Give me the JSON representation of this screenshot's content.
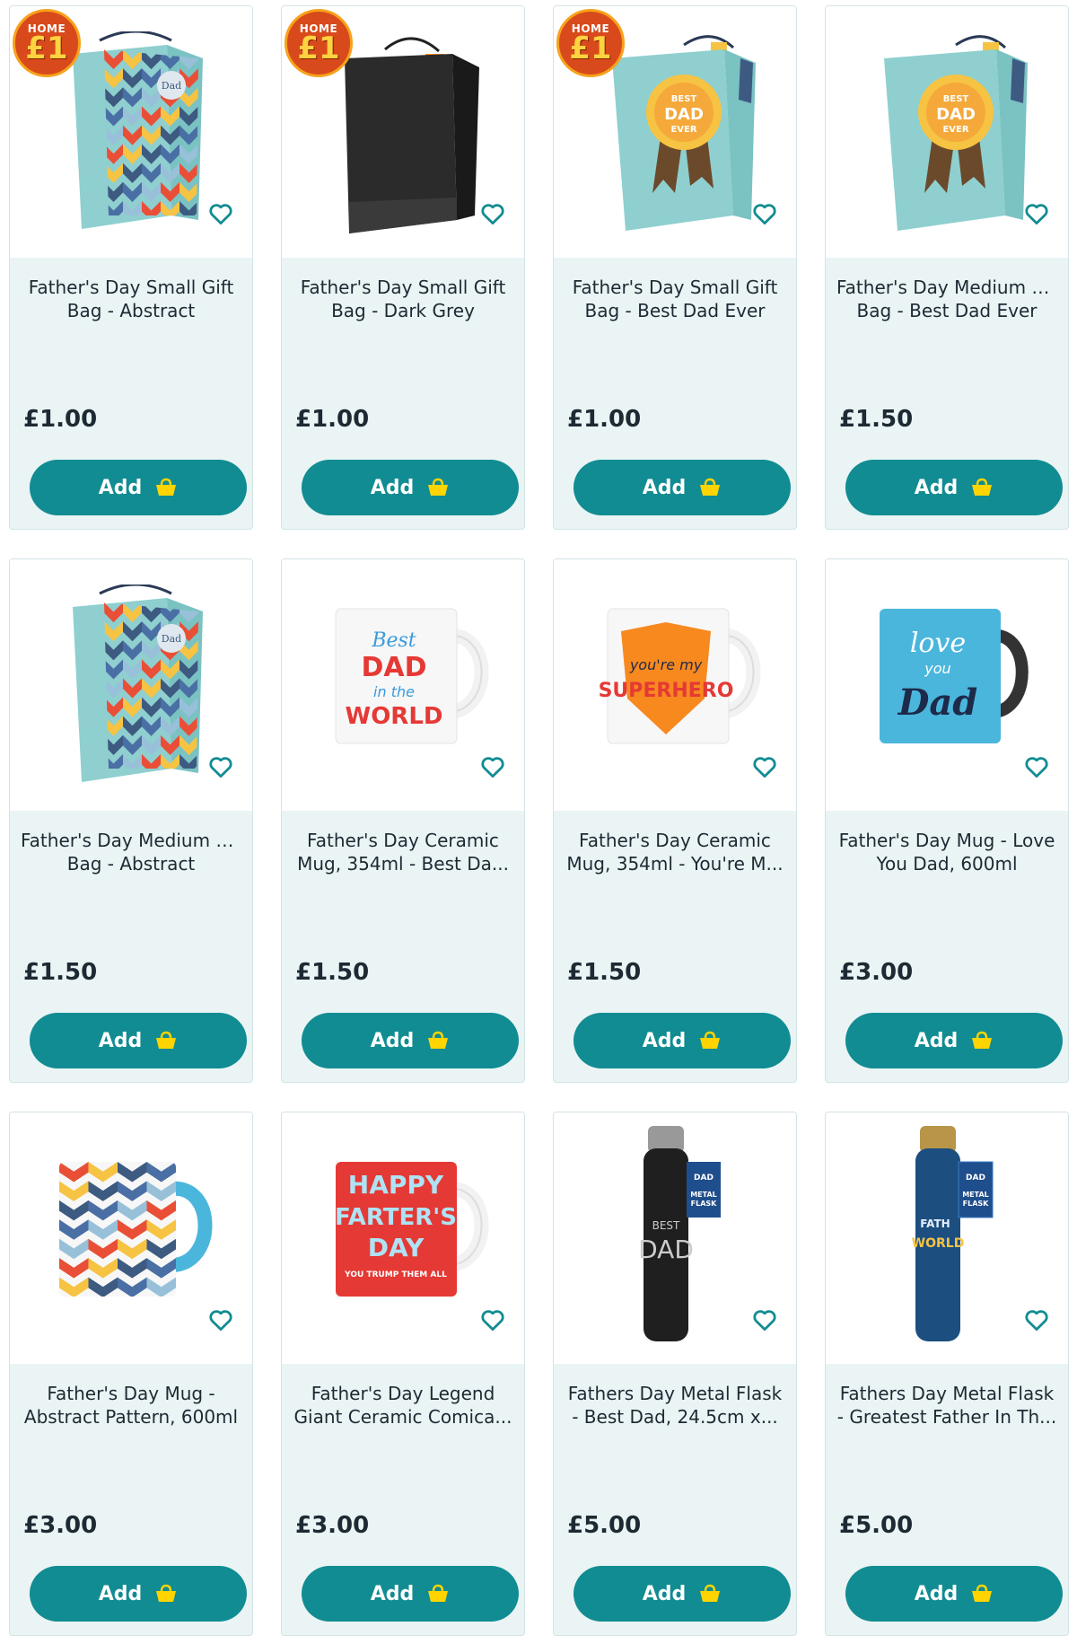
{
  "badge": {
    "line1": "HOME",
    "line2": "£1"
  },
  "add_label": "Add",
  "colors": {
    "accent": "#118c92",
    "card_bg": "#eaf4f5",
    "basket": "#ffd400",
    "badge": "#d84a1b"
  },
  "products": [
    {
      "title_l1": "Father's Day Small Gift",
      "title_l2": "Bag - Abstract",
      "price": "£1.00",
      "badge": true,
      "image": "gift-bag-chevron"
    },
    {
      "title_l1": "Father's Day Small Gift",
      "title_l2": "Bag - Dark Grey",
      "price": "£1.00",
      "badge": true,
      "image": "gift-bag-black"
    },
    {
      "title_l1": "Father's Day Small Gift",
      "title_l2": "Bag - Best Dad Ever",
      "price": "£1.00",
      "badge": true,
      "image": "gift-bag-rosette"
    },
    {
      "title_l1": "Father's Day Medium Gift",
      "title_l2": "Bag - Best Dad Ever",
      "price": "£1.50",
      "badge": false,
      "image": "gift-bag-rosette"
    },
    {
      "title_l1": "Father's Day Medium Gift",
      "title_l2": "Bag - Abstract",
      "price": "£1.50",
      "badge": false,
      "image": "gift-bag-chevron"
    },
    {
      "title_l1": "Father's Day Ceramic",
      "title_l2": "Mug, 354ml - Best Da...",
      "price": "£1.50",
      "badge": false,
      "image": "mug-best-dad"
    },
    {
      "title_l1": "Father's Day Ceramic",
      "title_l2": "Mug, 354ml - You're M...",
      "price": "£1.50",
      "badge": false,
      "image": "mug-superhero"
    },
    {
      "title_l1": "Father's Day Mug - Love",
      "title_l2": "You Dad, 600ml",
      "price": "£3.00",
      "badge": false,
      "image": "mug-love-you-dad"
    },
    {
      "title_l1": "Father's Day Mug -",
      "title_l2": "Abstract Pattern, 600ml",
      "price": "£3.00",
      "badge": false,
      "image": "mug-chevron"
    },
    {
      "title_l1": "Father's Day Legend",
      "title_l2": "Giant Ceramic Comica...",
      "price": "£3.00",
      "badge": false,
      "image": "mug-farters-day"
    },
    {
      "title_l1": "Fathers Day Metal Flask",
      "title_l2": "- Best Dad, 24.5cm x...",
      "price": "£5.00",
      "badge": false,
      "image": "flask-black"
    },
    {
      "title_l1": "Fathers Day Metal Flask",
      "title_l2": "- Greatest Father In Th...",
      "price": "£5.00",
      "badge": false,
      "image": "flask-blue"
    }
  ],
  "art": {
    "mug_best": [
      "Best",
      "DAD",
      "in the",
      "WORLD"
    ],
    "mug_super": [
      "you're my",
      "SUPERHERO"
    ],
    "mug_love": [
      "love",
      "you",
      "Dad"
    ],
    "mug_farters": [
      "HAPPY",
      "FARTER'S",
      "DAY",
      "YOU TRUMP THEM ALL"
    ],
    "flask_tag": [
      "DAD",
      "METAL",
      "FLASK"
    ],
    "flask_black": [
      "BEST",
      "DAD"
    ],
    "flask_blue": [
      "FATH",
      "WORLD"
    ],
    "rosette": [
      "BEST",
      "DAD",
      "EVER"
    ],
    "bag_tag": "Dad"
  }
}
